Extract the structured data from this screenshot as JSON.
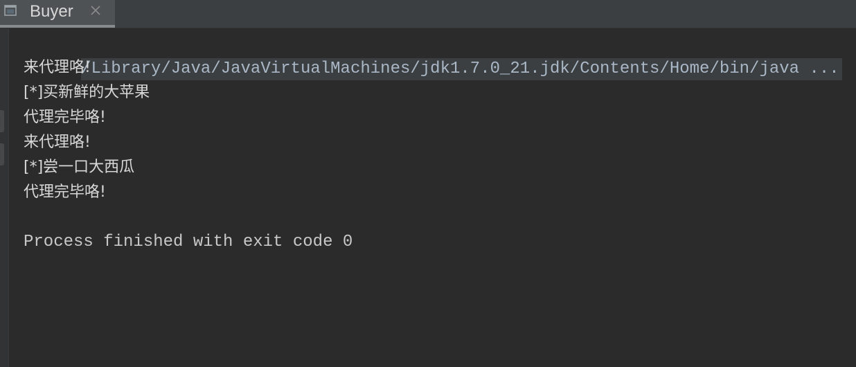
{
  "tab": {
    "title": "Buyer",
    "icon": "console-window-icon",
    "close_icon": "close-icon"
  },
  "console": {
    "command": "/Library/Java/JavaVirtualMachines/jdk1.7.0_21.jdk/Contents/Home/bin/java ...",
    "output": [
      "来代理咯!",
      "[*]买新鲜的大苹果",
      "代理完毕咯!",
      "来代理咯!",
      "[*]尝一口大西瓜",
      "代理完毕咯!"
    ],
    "exit_message": "Process finished with exit code 0"
  },
  "colors": {
    "background": "#2b2b2b",
    "tab_background": "#4e5254",
    "tab_bar": "#3c3f41",
    "command_highlight": "#3c3f41",
    "text": "#d4d4d4"
  }
}
